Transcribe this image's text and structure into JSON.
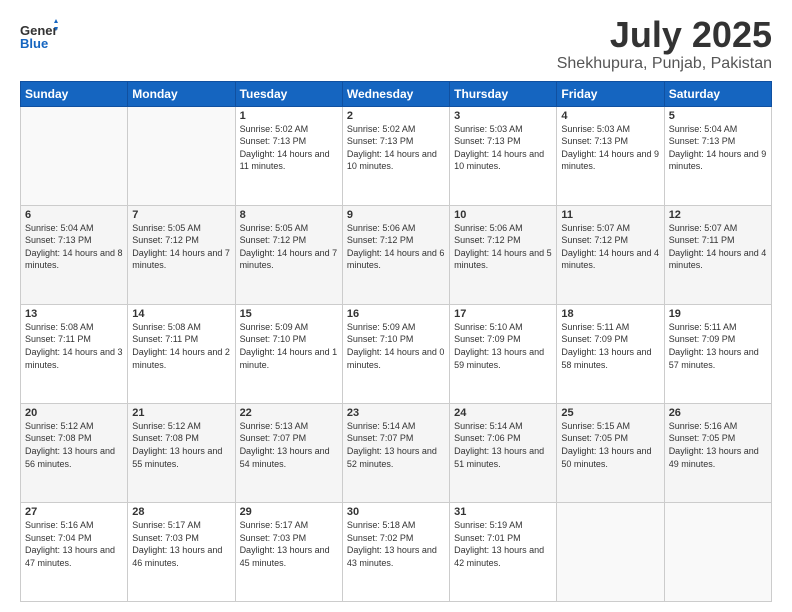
{
  "header": {
    "logo_general": "General",
    "logo_blue": "Blue",
    "main_title": "July 2025",
    "subtitle": "Shekhupura, Punjab, Pakistan"
  },
  "days_of_week": [
    "Sunday",
    "Monday",
    "Tuesday",
    "Wednesday",
    "Thursday",
    "Friday",
    "Saturday"
  ],
  "weeks": [
    [
      {
        "day": "",
        "info": ""
      },
      {
        "day": "",
        "info": ""
      },
      {
        "day": "1",
        "sunrise": "5:02 AM",
        "sunset": "7:13 PM",
        "daylight": "14 hours and 11 minutes."
      },
      {
        "day": "2",
        "sunrise": "5:02 AM",
        "sunset": "7:13 PM",
        "daylight": "14 hours and 10 minutes."
      },
      {
        "day": "3",
        "sunrise": "5:03 AM",
        "sunset": "7:13 PM",
        "daylight": "14 hours and 10 minutes."
      },
      {
        "day": "4",
        "sunrise": "5:03 AM",
        "sunset": "7:13 PM",
        "daylight": "14 hours and 9 minutes."
      },
      {
        "day": "5",
        "sunrise": "5:04 AM",
        "sunset": "7:13 PM",
        "daylight": "14 hours and 9 minutes."
      }
    ],
    [
      {
        "day": "6",
        "sunrise": "5:04 AM",
        "sunset": "7:13 PM",
        "daylight": "14 hours and 8 minutes."
      },
      {
        "day": "7",
        "sunrise": "5:05 AM",
        "sunset": "7:12 PM",
        "daylight": "14 hours and 7 minutes."
      },
      {
        "day": "8",
        "sunrise": "5:05 AM",
        "sunset": "7:12 PM",
        "daylight": "14 hours and 7 minutes."
      },
      {
        "day": "9",
        "sunrise": "5:06 AM",
        "sunset": "7:12 PM",
        "daylight": "14 hours and 6 minutes."
      },
      {
        "day": "10",
        "sunrise": "5:06 AM",
        "sunset": "7:12 PM",
        "daylight": "14 hours and 5 minutes."
      },
      {
        "day": "11",
        "sunrise": "5:07 AM",
        "sunset": "7:12 PM",
        "daylight": "14 hours and 4 minutes."
      },
      {
        "day": "12",
        "sunrise": "5:07 AM",
        "sunset": "7:11 PM",
        "daylight": "14 hours and 4 minutes."
      }
    ],
    [
      {
        "day": "13",
        "sunrise": "5:08 AM",
        "sunset": "7:11 PM",
        "daylight": "14 hours and 3 minutes."
      },
      {
        "day": "14",
        "sunrise": "5:08 AM",
        "sunset": "7:11 PM",
        "daylight": "14 hours and 2 minutes."
      },
      {
        "day": "15",
        "sunrise": "5:09 AM",
        "sunset": "7:10 PM",
        "daylight": "14 hours and 1 minute."
      },
      {
        "day": "16",
        "sunrise": "5:09 AM",
        "sunset": "7:10 PM",
        "daylight": "14 hours and 0 minutes."
      },
      {
        "day": "17",
        "sunrise": "5:10 AM",
        "sunset": "7:09 PM",
        "daylight": "13 hours and 59 minutes."
      },
      {
        "day": "18",
        "sunrise": "5:11 AM",
        "sunset": "7:09 PM",
        "daylight": "13 hours and 58 minutes."
      },
      {
        "day": "19",
        "sunrise": "5:11 AM",
        "sunset": "7:09 PM",
        "daylight": "13 hours and 57 minutes."
      }
    ],
    [
      {
        "day": "20",
        "sunrise": "5:12 AM",
        "sunset": "7:08 PM",
        "daylight": "13 hours and 56 minutes."
      },
      {
        "day": "21",
        "sunrise": "5:12 AM",
        "sunset": "7:08 PM",
        "daylight": "13 hours and 55 minutes."
      },
      {
        "day": "22",
        "sunrise": "5:13 AM",
        "sunset": "7:07 PM",
        "daylight": "13 hours and 54 minutes."
      },
      {
        "day": "23",
        "sunrise": "5:14 AM",
        "sunset": "7:07 PM",
        "daylight": "13 hours and 52 minutes."
      },
      {
        "day": "24",
        "sunrise": "5:14 AM",
        "sunset": "7:06 PM",
        "daylight": "13 hours and 51 minutes."
      },
      {
        "day": "25",
        "sunrise": "5:15 AM",
        "sunset": "7:05 PM",
        "daylight": "13 hours and 50 minutes."
      },
      {
        "day": "26",
        "sunrise": "5:16 AM",
        "sunset": "7:05 PM",
        "daylight": "13 hours and 49 minutes."
      }
    ],
    [
      {
        "day": "27",
        "sunrise": "5:16 AM",
        "sunset": "7:04 PM",
        "daylight": "13 hours and 47 minutes."
      },
      {
        "day": "28",
        "sunrise": "5:17 AM",
        "sunset": "7:03 PM",
        "daylight": "13 hours and 46 minutes."
      },
      {
        "day": "29",
        "sunrise": "5:17 AM",
        "sunset": "7:03 PM",
        "daylight": "13 hours and 45 minutes."
      },
      {
        "day": "30",
        "sunrise": "5:18 AM",
        "sunset": "7:02 PM",
        "daylight": "13 hours and 43 minutes."
      },
      {
        "day": "31",
        "sunrise": "5:19 AM",
        "sunset": "7:01 PM",
        "daylight": "13 hours and 42 minutes."
      },
      {
        "day": "",
        "info": ""
      },
      {
        "day": "",
        "info": ""
      }
    ]
  ]
}
